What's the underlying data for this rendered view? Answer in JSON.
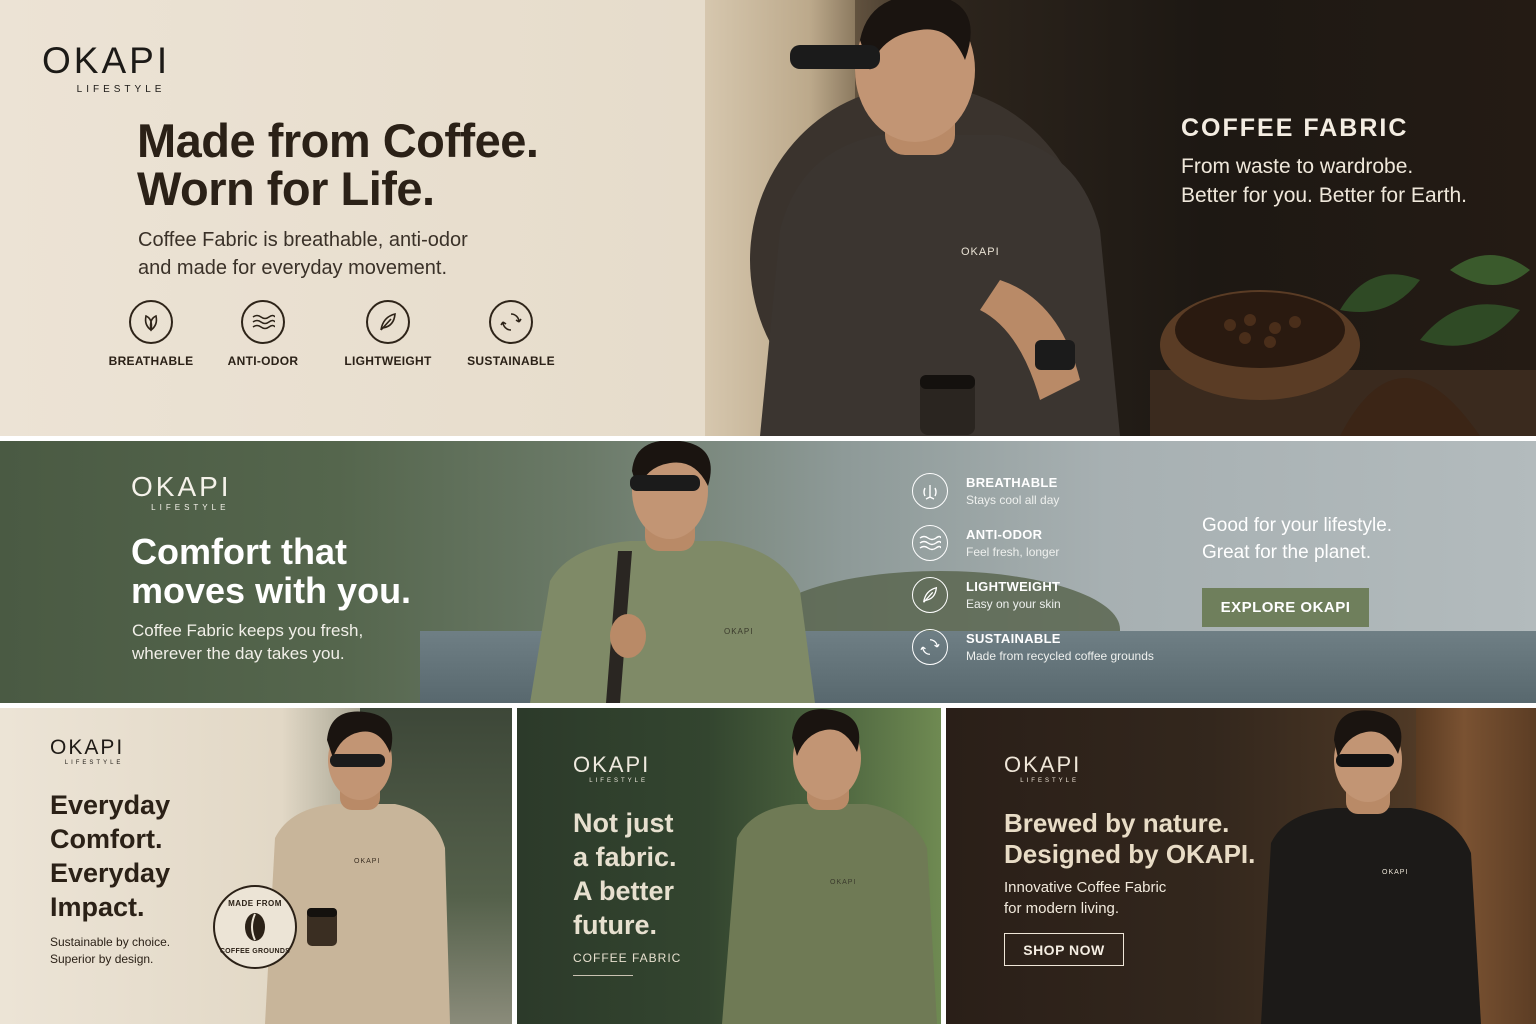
{
  "banner1": {
    "logo": {
      "main": "OKAPI",
      "sub": "LIFESTYLE"
    },
    "headline": [
      "Made from Coffee.",
      "Worn for Life."
    ],
    "description": [
      "Coffee Fabric is breathable, anti-odor",
      "and made for everyday movement."
    ],
    "features": [
      {
        "label": "BREATHABLE",
        "icon": "leaf-pair-icon"
      },
      {
        "label": "ANTI-ODOR",
        "icon": "waves-icon"
      },
      {
        "label": "LIGHTWEIGHT",
        "icon": "feather-icon"
      },
      {
        "label": "SUSTAINABLE",
        "icon": "recycle-icon"
      }
    ],
    "side_title": "COFFEE FABRIC",
    "side_lines": [
      "From waste to wardrobe.",
      "Better for you. Better for Earth."
    ],
    "tee_logo": "OKAPI"
  },
  "banner2": {
    "logo": {
      "main": "OKAPI",
      "sub": "LIFESTYLE"
    },
    "headline": [
      "Comfort that",
      "moves with you."
    ],
    "description": [
      "Coffee Fabric keeps you fresh,",
      "wherever the day takes you."
    ],
    "features": [
      {
        "title": "BREATHABLE",
        "subtitle": "Stays cool all day",
        "icon": "breathe-icon"
      },
      {
        "title": "ANTI-ODOR",
        "subtitle": "Feel fresh, longer",
        "icon": "waves-icon"
      },
      {
        "title": "LIGHTWEIGHT",
        "subtitle": "Easy on your skin",
        "icon": "feather-icon"
      },
      {
        "title": "SUSTAINABLE",
        "subtitle": "Made from recycled coffee grounds",
        "icon": "recycle-icon"
      }
    ],
    "tagline": [
      "Good for your lifestyle.",
      "Great for the planet."
    ],
    "button": "EXPLORE OKAPI",
    "tee_logo": "OKAPI"
  },
  "banner3": {
    "logo": {
      "main": "OKAPI",
      "sub": "LIFESTYLE"
    },
    "headline": [
      "Everyday",
      "Comfort.",
      "Everyday",
      "Impact."
    ],
    "description": [
      "Sustainable by choice.",
      "Superior by design."
    ],
    "badge": {
      "top": "MADE FROM",
      "bottom": "COFFEE GROUNDS"
    },
    "tee_logo": "OKAPI"
  },
  "banner4": {
    "logo": {
      "main": "OKAPI",
      "sub": "LIFESTYLE"
    },
    "headline": [
      "Not just",
      "a fabric.",
      "A better",
      "future."
    ],
    "label": "COFFEE FABRIC",
    "tee_logo": "OKAPI"
  },
  "banner5": {
    "logo": {
      "main": "OKAPI",
      "sub": "LIFESTYLE"
    },
    "headline": [
      "Brewed by nature.",
      "Designed by OKAPI."
    ],
    "description": [
      "Innovative Coffee Fabric",
      "for modern living."
    ],
    "button": "SHOP NOW",
    "tee_logo": "OKAPI"
  },
  "colors": {
    "olive_button": "#6f7f5c",
    "dark_brown_text": "#2b2117",
    "cream": "#ece4d6"
  }
}
